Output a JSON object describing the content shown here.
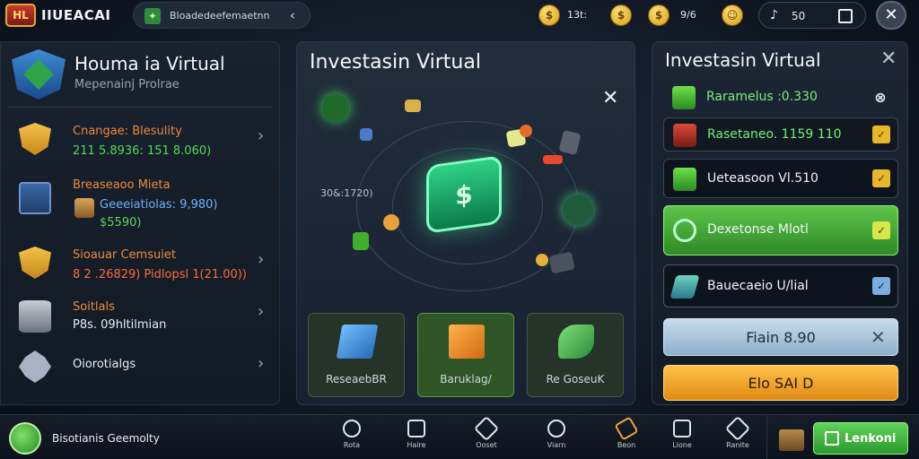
{
  "topbar": {
    "logo_text": "HL",
    "app_title": "IIUEACAI",
    "search_text": "Bloadedeefemaetnn",
    "chevron": "‹",
    "currencies": [
      {
        "icon": "coin-icon",
        "value": "13t:"
      },
      {
        "icon": "coin-icon",
        "value": "9/6"
      },
      {
        "icon": "smiley-coin-icon",
        "value": ""
      }
    ],
    "sound_value": "50",
    "close": "✕"
  },
  "left_panel": {
    "title": "Houma ia Virtual",
    "subtitle": "Mepenainj Prolrae",
    "rows": [
      {
        "icon": "shield-icon",
        "name": "Cnangae: Blesulity",
        "line2": "211 5.8936: 151 8.060)",
        "line2_color": "#58d85a"
      },
      {
        "icon": "box-icon",
        "name": "Breaseaoo Mieta",
        "line2": "Geeeiatiolas: 9,980)",
        "line3": "$5590)",
        "line2_color": "#6fb0ff"
      },
      {
        "icon": "shield-icon",
        "name": "Sioauar Cemsuiet",
        "line2": "8 2 .26829) Pidlopsl 1(21.00))",
        "line2_color": "#ff6a3a"
      },
      {
        "icon": "database-icon",
        "name": "Soitlals",
        "line2": "P8s. 09hltilmian",
        "line2_color": "#e8eef6"
      },
      {
        "icon": "puzzle-icon",
        "name": "Oiorotialgs",
        "line2": "",
        "line2_color": "#e8eef6"
      }
    ]
  },
  "center_panel": {
    "title": "Investasin Virtual",
    "close": "✕",
    "orbit_label": "30&:1720)",
    "hub_glyph": "$",
    "cards": [
      {
        "label": "ReseaebBR",
        "bg": "#2a3a2e"
      },
      {
        "label": "Baruklag/",
        "bg": "#2f5a26"
      },
      {
        "label": "Re GoseuK",
        "bg": "#2a3a2e"
      }
    ]
  },
  "right_panel": {
    "title": "Investasin Virtual",
    "close": "✕",
    "items": [
      {
        "icon": "cube-icon",
        "label": "Raramelus :0.330",
        "check": "⊗",
        "style": "plain"
      },
      {
        "icon": "chest-icon",
        "label": "Rasetaneo. 1159 110",
        "check": "✓",
        "style": "outlined"
      },
      {
        "icon": "cube-icon",
        "label": "Ueteasoon Vl.510",
        "check": "✓",
        "style": "outlined"
      },
      {
        "icon": "gear-icon",
        "label": "Dexetonse Mlotl",
        "check": "✓",
        "style": "green"
      },
      {
        "icon": "tile-icon",
        "label": "Bauecaeio U/lial",
        "check": "✓",
        "style": "outlined-blue"
      }
    ],
    "primary_button": "Fiain 8.90",
    "primary_close": "✕",
    "secondary_button": "Elo SAI D"
  },
  "bottom_bar": {
    "username": "Bisotianis Geemolty",
    "nav": [
      {
        "icon": "globe-icon",
        "label": "Rota"
      },
      {
        "icon": "document-icon",
        "label": "Haire"
      },
      {
        "icon": "tag-icon",
        "label": "Ooset"
      },
      {
        "icon": "search-icon",
        "label": "Viarn"
      },
      {
        "icon": "ticket-icon",
        "label": "Beon"
      },
      {
        "icon": "cart-icon",
        "label": "Lione"
      },
      {
        "icon": "diamond-icon",
        "label": "Ranite"
      }
    ],
    "play_button": "Lenkoni"
  },
  "colors": {
    "accent_green": "#2fd186",
    "accent_orange": "#f08a3c",
    "primary_blue": "#8fb0cc",
    "button_orange": "#e08a14"
  }
}
